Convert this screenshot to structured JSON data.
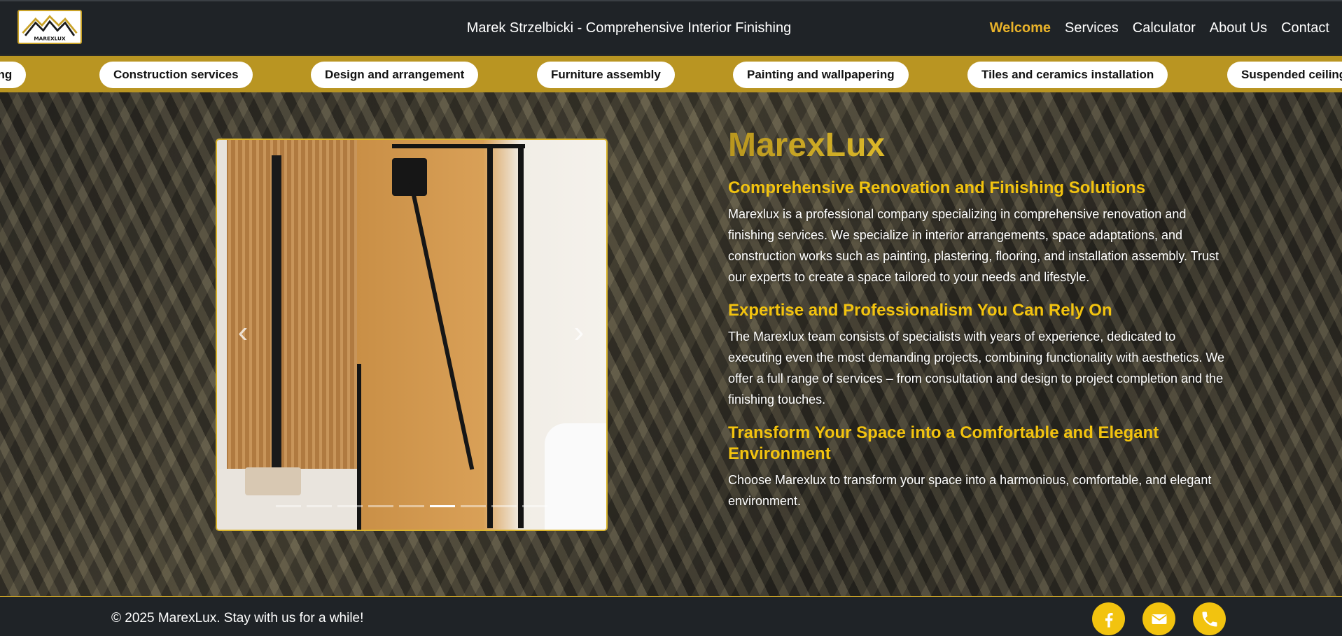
{
  "header": {
    "title": "Marek Strzelbicki - Comprehensive Interior Finishing",
    "logo_text": "MAREXLUX"
  },
  "nav": {
    "items": [
      {
        "label": "Welcome",
        "active": true
      },
      {
        "label": "Services",
        "active": false
      },
      {
        "label": "Calculator",
        "active": false
      },
      {
        "label": "About Us",
        "active": false
      },
      {
        "label": "Contact",
        "active": false
      }
    ]
  },
  "services_band": {
    "items": [
      "Remodeling",
      "Construction services",
      "Design and arrangement",
      "Furniture assembly",
      "Painting and wallpapering",
      "Tiles and ceramics installation",
      "Suspended ceilings"
    ]
  },
  "carousel": {
    "prev_icon": "chevron-left-icon",
    "next_icon": "chevron-right-icon",
    "slide_count": 9,
    "active_index": 5
  },
  "main": {
    "brand": "MarexLux",
    "sections": [
      {
        "heading": "Comprehensive Renovation and Finishing Solutions",
        "body": "Marexlux is a professional company specializing in comprehensive renovation and finishing services. We specialize in interior arrangements, space adaptations, and construction works such as painting, plastering, flooring, and installation assembly. Trust our experts to create a space tailored to your needs and lifestyle."
      },
      {
        "heading": "Expertise and Professionalism You Can Rely On",
        "body": "The Marexlux team consists of specialists with years of experience, dedicated to executing even the most demanding projects, combining functionality with aesthetics. We offer a full range of services – from consultation and design to project completion and the finishing touches."
      },
      {
        "heading": "Transform Your Space into a Comfortable and Elegant Environment",
        "body": "Choose Marexlux to transform your space into a harmonious, comfortable, and elegant environment."
      }
    ]
  },
  "footer": {
    "copyright": "© 2025 MarexLux. Stay with us for a while!",
    "socials": [
      "facebook-icon",
      "mail-icon",
      "phone-icon"
    ]
  },
  "colors": {
    "accent": "#f2c30f",
    "band": "#b99522",
    "header_bg": "#1f2327",
    "nav_active": "#e8b22a"
  }
}
